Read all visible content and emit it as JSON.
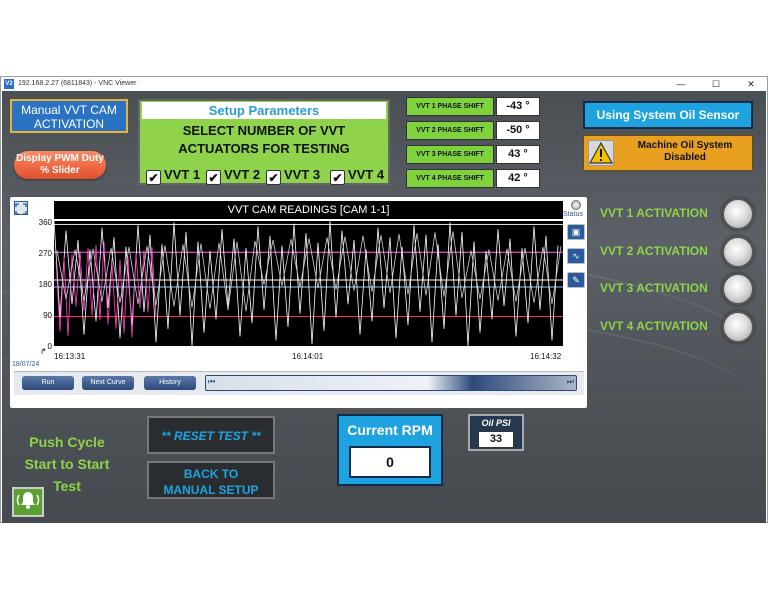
{
  "window": {
    "title": "192.168.2.27 (6811843) - VNC Viewer",
    "app_icon_text": "V2",
    "minimize_glyph": "—",
    "maximize_glyph": "☐",
    "close_glyph": "✕"
  },
  "header": {
    "mode_label": "Manual VVT CAM ACTIVATION",
    "pwm_button": "Display PWM Duty % Slider"
  },
  "setup": {
    "title": "Setup Parameters",
    "line1": "SELECT NUMBER OF  VVT",
    "line2": "ACTUATORS FOR  TESTING",
    "checkboxes": [
      {
        "label": "VVT 1",
        "checked": true
      },
      {
        "label": "VVT 2",
        "checked": true
      },
      {
        "label": "VVT 3",
        "checked": true
      },
      {
        "label": "VVT 4",
        "checked": true
      }
    ],
    "check_glyph": "✔"
  },
  "phase_shifts": [
    {
      "label": "VVT 1 PHASE SHIFT",
      "value": "-43 °"
    },
    {
      "label": "VVT 2 PHASE SHIFT",
      "value": "-50 °"
    },
    {
      "label": "VVT 3 PHASE SHIFT",
      "value": "43 °"
    },
    {
      "label": "VVT 4 PHASE SHIFT",
      "value": "42 °"
    }
  ],
  "oil": {
    "sensor_label": "Using System Oil Sensor",
    "machine_oil": "Machine Oil System Disabled",
    "warning_icon": "warning-icon"
  },
  "activations": [
    {
      "label": "VVT 1 ACTIVATION"
    },
    {
      "label": "VVT 2 ACTIVATION"
    },
    {
      "label": "VVT 3 ACTIVATION"
    },
    {
      "label": "VVT 4 ACTIVATION"
    }
  ],
  "trend": {
    "title": "VVT CAM READINGS [CAM 1-1]",
    "status_label": "Status",
    "date": "18/07/24",
    "buttons": [
      "Run",
      "Next Curve",
      "History"
    ],
    "scroll_start": "⏮",
    "scroll_end": "⏭"
  },
  "chart_data": {
    "type": "line",
    "title": "VVT CAM READINGS [CAM 1-1]",
    "y_ticks": [
      "360",
      "270",
      "180",
      "90",
      "0"
    ],
    "ylim": [
      0,
      360
    ],
    "x_ticks": [
      "16:13:31",
      "16:14:01",
      "16:14:32"
    ],
    "grid": false,
    "reference_lines": [
      {
        "color": "#d8d8d8",
        "value": 350
      },
      {
        "color": "#ff66ff",
        "value": 270
      },
      {
        "color": "#ffffff",
        "value": 190
      },
      {
        "color": "#88ccff",
        "value": 170
      },
      {
        "color": "#ff3333",
        "value": 85
      }
    ],
    "series": [
      {
        "color": "#ffffff",
        "pattern": "sawtooth",
        "min": 0,
        "max": 360
      },
      {
        "color": "#ff44cc",
        "pattern": "sawtooth",
        "min": 20,
        "max": 300
      },
      {
        "color": "#d0d0d0",
        "pattern": "sawtooth",
        "min": 100,
        "max": 330
      }
    ]
  },
  "footer": {
    "push_text": "Push Cycle Start to Start Test",
    "reset_button": "** RESET TEST **",
    "back_button_line1": "BACK TO",
    "back_button_line2": "MANUAL SETUP",
    "rpm_label": "Current RPM",
    "rpm_value": "0",
    "oil_psi_label": "Oil PSI",
    "oil_psi_value": "33",
    "alarm_icon": "alarm-bell-icon"
  }
}
